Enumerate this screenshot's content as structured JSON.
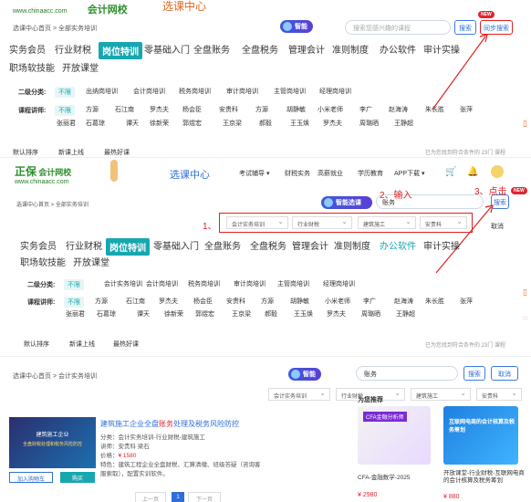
{
  "site": {
    "url": "www.chinaacc.com",
    "logo_brand": "正保",
    "logo_name": "会计网校",
    "logo_sub": "选课中心"
  },
  "panel1": {
    "breadcrumb": "选课中心首页 > 全部实务培训",
    "smart_label": "智能",
    "search_placeholder": "搜索您感兴趣的课程",
    "search_btn": "搜索",
    "sync_btn": "同步搜索",
    "new_badge": "NEW",
    "tabs": [
      "实务会员",
      "行业财税",
      "岗位特训",
      "零基础入门",
      "全盘账务",
      "全盘税务",
      "管理会计",
      "准则制度",
      "办公软件",
      "审计实操",
      "职场软技能",
      "开放课堂"
    ],
    "row1_label": "二级分类:",
    "row1": [
      "不限",
      "出纳岗培训",
      "会计岗培训",
      "税务岗培训",
      "审计岗培训",
      "主管岗培训",
      "经理岗培训"
    ],
    "row2_label": "课程讲师:",
    "row2a": [
      "不限",
      "方源",
      "石江南",
      "罗杰夫",
      "杨会臣",
      "安贵科",
      "方源",
      "胡静敏",
      "小米老师",
      "李广",
      "赵海涛",
      "朱长胜",
      "张萍"
    ],
    "row2b": [
      "张丽君",
      "石葛琼",
      "谭天",
      "徐新荣",
      "郭煜宏",
      "王京梁",
      "郝毅",
      "王玉焕",
      "罗杰夫",
      "周璐晒",
      "王静超"
    ],
    "sort": [
      "默认排序",
      "新课上线",
      "最热好课"
    ],
    "result_text": "已为您找到符合条件的 23门 课程"
  },
  "panel2": {
    "breadcrumb": "选课中心首页 > 全部实务培训",
    "nav": [
      "考试辅导 ▾",
      "财税实务",
      "高薪就业",
      "学历教育",
      "APP下载 ▾"
    ],
    "smart_label": "智能选课",
    "search_value": "账务",
    "search_btn": "搜索",
    "cancel_btn": "取消",
    "new_badge": "NEW",
    "filters": [
      "会计实务培训",
      "行业财税",
      "建筑施工",
      "安贵科"
    ],
    "annot1": "1、",
    "annot2": "2、输入",
    "annot3": "3、点击",
    "tabs": [
      "实务会员",
      "行业财税",
      "岗位特训",
      "零基础入门",
      "全盘账务",
      "全盘税务",
      "管理会计",
      "准则制度",
      "办公软件",
      "审计实操",
      "职场软技能",
      "开放课堂"
    ],
    "row1_label": "二级分类:",
    "row1": [
      "不限",
      "会计实务培训",
      "会计岗培训",
      "税务岗培训",
      "审计岗培训",
      "主管岗培训",
      "经理岗培训"
    ],
    "row2_label": "课程讲师:",
    "row2a": [
      "不限",
      "方源",
      "石江南",
      "罗杰夫",
      "杨会臣",
      "安贵科",
      "方源",
      "胡静敏",
      "小米老师",
      "李广",
      "赵海涛",
      "朱长胜",
      "张萍"
    ],
    "row2b": [
      "张丽君",
      "石葛琼",
      "谭天",
      "徐新荣",
      "郭煜宏",
      "王京梁",
      "郝毅",
      "王玉焕",
      "罗杰夫",
      "周璐晒",
      "王静超"
    ],
    "sort": [
      "默认排序",
      "新课上线",
      "最热好课"
    ],
    "result_text": "已为您找到符合条件的 23门 课程"
  },
  "panel3": {
    "breadcrumb": "选课中心首页 > 会计实务培训",
    "smart_label": "智能",
    "search_value": "账务",
    "search_btn": "搜索",
    "cancel_btn": "取消",
    "filters": [
      "会计实务培训",
      "行业财税",
      "建筑施工",
      "安贵科"
    ],
    "course": {
      "title_pre": "建筑施工企业全盘",
      "title_hl": "账务",
      "title_post": "处理及税务风险防控",
      "cover_text1": "建筑施工企业",
      "cover_text2": "全盘财税处理和税务风险防控",
      "line1": "分类：会计实务培训-行业财税-建筑施工",
      "line2": "讲师：安贵科 梁石",
      "line3_label": "价格：",
      "price": "¥ 1580",
      "line4": "特色：建筑工程企业全盘财税、汇算清缴、班级答疑（咨询客服索取），配置实训软件。",
      "cart_btn": "加入购物车",
      "buy_btn": "购买"
    },
    "pager": [
      "上一页",
      "1",
      "下一页"
    ],
    "recommend_title": "为您推荐",
    "rec1": {
      "cover": "CFA金融分析师",
      "name": "CFA-金融数学-2025",
      "price": "¥ 2980"
    },
    "rec2": {
      "cover": "互联网电商的会计核算及税务筹划",
      "name": "开放课堂-行业财税-互联网电商的会计核算及税务筹划",
      "price": "¥ 880"
    }
  },
  "colors": {
    "accent": "#17a7b0",
    "blue": "#2f6ed8",
    "red": "#e02020"
  }
}
